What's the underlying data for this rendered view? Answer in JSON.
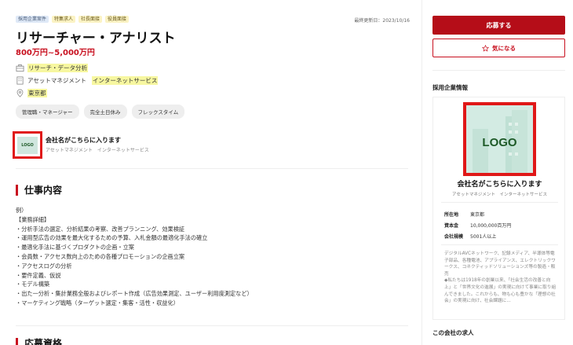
{
  "tags": [
    "採用企業案件",
    "特集求人",
    "社長面接",
    "役員面接"
  ],
  "updated": "最終更新日：2023/10/16",
  "job_title": "リサーチャー・アナリスト",
  "salary": "800万円~5,000万円",
  "meta": {
    "category": "リサーチ・データ分析",
    "industry_1": "アセットマネジメント",
    "industry_2": "インターネットサービス",
    "location": "東京都"
  },
  "pills": [
    "管理職・マネージャー",
    "完全土日休み",
    "フレックスタイム"
  ],
  "company": {
    "logo_text": "LOGO",
    "name": "会社名がこちらに入ります",
    "industry": "アセットマネジメント　インターネットサービス"
  },
  "section_job": {
    "heading": "仕事内容",
    "lines": [
      "例）",
      "【業務詳細】",
      "・分析手法の選定、分析結果の考察、改善プランニング、効果検証",
      "・運用型広告の効果を最大化するための予算、入札金額の最適化手法の確立",
      "・最適化手法に基づくプロダクトの企画・立案",
      "・会員数・アクセス数向上のための各種プロモーションの企画立案",
      "・アクセスログの分析",
      "・要件定義、仮説",
      "・モデル構築",
      "・出た一分析・集計業務全般およびレポート作成（広告効果測定、ユーザー利用度測定など）",
      "・マーケティング戦略（ターゲット選定・集客・活性・収益化）"
    ]
  },
  "section_qual": {
    "heading": "応募資格"
  },
  "sidebar": {
    "apply_label": "応募する",
    "fav_label": "気になる",
    "company_section_title": "採用企業情報",
    "info": [
      {
        "k": "所在地",
        "v": "東京都"
      },
      {
        "k": "資本金",
        "v": "10,000,000百万円"
      },
      {
        "k": "会社規模",
        "v": "5001人以上"
      }
    ],
    "company_text": "デジタルAVCネットワーク、記録メディア、半導体等電子部品、各種電池、アプライアンス、エレクトリックワークス、コネクティッドソリューションズ等の製造・販売\n◆私たちは1918年の創業以来、「社会生活の改善と向上」と「世界文化の進展」の実現に向けて事業に取り組んできました。これからも、物も心も豊かな「理想の社会」の実現に向け、社会課題に...",
    "jobs_title": "この会社の求人"
  },
  "colors": {
    "accent": "#c8101f",
    "highlight": "#f7f7a0",
    "annotation_box": "#e01818"
  }
}
